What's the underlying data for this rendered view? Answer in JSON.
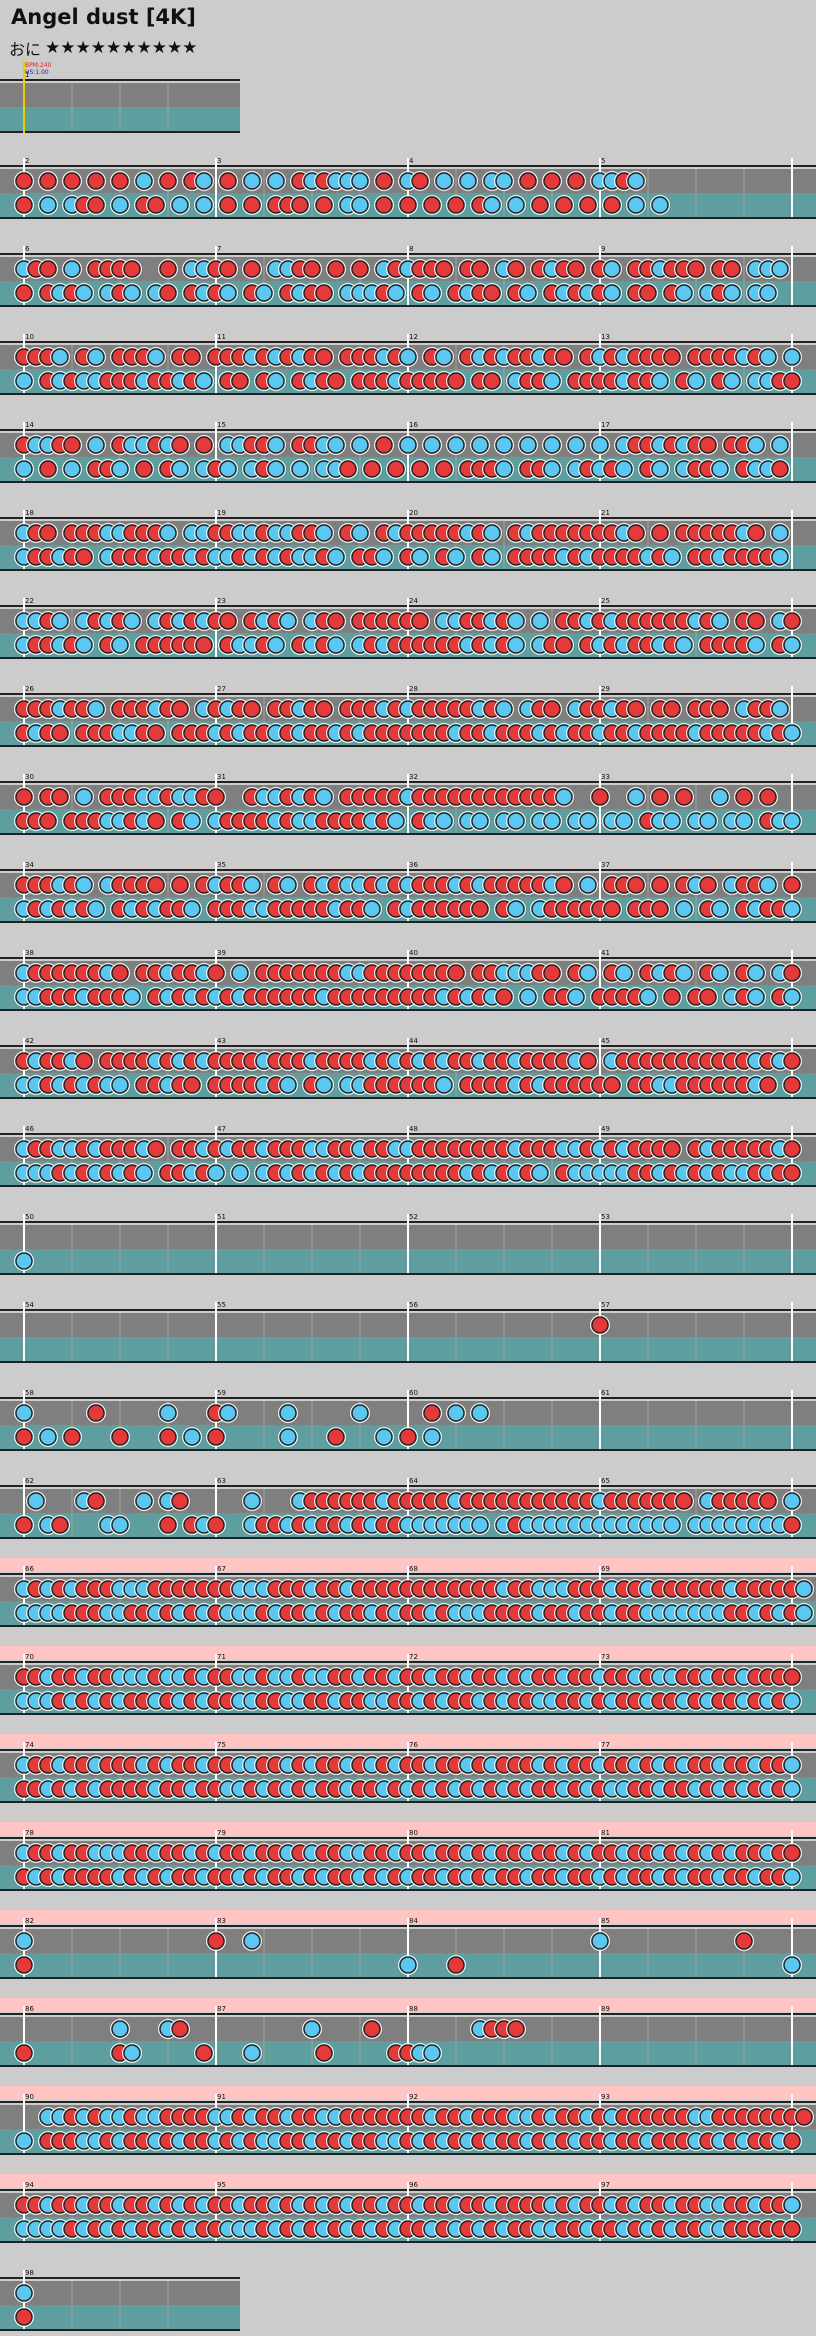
{
  "song": {
    "title": "Angel dust [4K]",
    "difficulty_label": "おに",
    "stars": "★★★★★★★★★★"
  },
  "header_marks": {
    "bpm": "BPM:240",
    "hs": "HS:1.00"
  },
  "colors": {
    "background": "#cccccc",
    "lane_top": "#7f7f7f",
    "lane_bottom": "#5f9e9e",
    "gogo_band": "#ffc4c4",
    "don": "#e63a3a",
    "ka": "#5ac8f0",
    "barline": "#ffffff",
    "beatline": "#a0a0a0",
    "start_line": "#e8d000",
    "measure_number": "#111111"
  },
  "chart": {
    "measures_per_row": 4,
    "divisions": 16,
    "rows": [
      {
        "first": 1,
        "count": 1,
        "gogo": false,
        "lanes": [
          "................",
          "................"
        ]
      },
      {
        "first": 2,
        "count": 4,
        "gogo": false,
        "lanes": [
          "o.o.o.o.o.k.o.ok.o.k.k.okokkk.o.ko.k.k.kk.o.o.o.kkok",
          "o.k.koo.k.oo.k.k.o.o.ooo.o.kk.o.o.o.o.ok.k.o.o.o.o.k.k"
        ]
      },
      {
        "first": 6,
        "count": 4,
        "gogo": false,
        "lanes": [
          "koo.k.oooo..o.kkoo.o.kkoo.o.o.kokooo.oo.ko.okoo.ok.ookooo.oo.kkk",
          "o.okok.kok.ko.okok.ok.okoo.kkkok.ok.okoo.ok.okokok.oo.ok.kok.kk"
        ]
      },
      {
        "first": 10,
        "count": 4,
        "gogo": false,
        "lanes": [
          "oook.ok.oook.oo.oookokokoo.oookok.ok.okokookoo.okokoooo.ooookok.k",
          "k.okokkoookookok.oo.ok.okoo.oookooooo.oo.kook.ooookook.ok.ok.kkoo"
        ]
      },
      {
        "first": 14,
        "count": 4,
        "gogo": false,
        "lanes": [
          "okkoo.k.okkoko.o.kkook.ookk.k.o.k.k.k.k.k.k.k.k.k.kookokoo.ook.k",
          "k.o.k.ook.o.ok.kok.kok.k.kko.o.o.o.o.oook.ook.kokok.ok.kook.okko"
        ]
      },
      {
        "first": 18,
        "count": 4,
        "gogo": false,
        "lanes": [
          "koo.oookkoook.kkookkokkook.ok.okoooookok.okoooooooko.o.oooooko.k",
          "kookoo.koookookokkokokokkok.ook.ok.ok.ok.ooookokooookok.ookooook"
        ]
      },
      {
        "first": 22,
        "count": 4,
        "gogo": false,
        "lanes": [
          "kkok.kokok.kokokoo.okok.koo.oooooo.kkookok.k.ookokooooookok.oo.ko",
          "kookok.ok.oooooo.okkok.okok.kokooooookokok.koo.okokookok.ooook.ok"
        ]
      },
      {
        "first": 26,
        "count": 4,
        "gogo": false,
        "lanes": [
          "oookook.oookoo.kokoo.ookoo.oookokoooookok.koo.kookoo.oo.ooo.kook",
          "okoo.oookkoo.oookokookokookokoooooookookoookokookookooookoooookok"
        ]
      },
      {
        "first": 30,
        "count": 4,
        "gogo": false,
        "lanes": [
          "o.oo.k.oookkokkoo..okkokok.oooookooooooooooook..o..k.o.o..k.o.o..",
          "ooo.oookkoko.ok.kooookokkooookok.okk.kk.kk.kk.kk.kk.okk.kk.kk.okk"
        ]
      },
      {
        "first": 34,
        "count": 4,
        "gogo": false,
        "lanes": [
          "oookok.koooo.o.okook.ok.okokkokokoookokoooooko.k.ooo.o.oko.kook.o",
          "kokokok.okokook.oookkoooookook.okoooooo.ok.koooooo.ooo.k.ok.okook"
        ]
      },
      {
        "first": 38,
        "count": 4,
        "gogo": false,
        "lanes": [
          "kooooooko.ookooko.k.oooooookkoooooooo.ookkkoo.ok.ok.okok.ok.ok.ko",
          "kkoookoook.okokokokooooookoooooooookokoko.k.ook.ooook.o.oo.kok.ok"
        ]
      },
      {
        "first": 42,
        "count": 4,
        "gogo": false,
        "lanes": [
          "okooko.ooookokokooookoookooookokokokookookooooko.koooooooooookoko",
          "kkokokokk.ookoo.ooookok.ok.kkooooook.ooookokoooooo.ookkooooooko.o"
        ]
      },
      {
        "first": 46,
        "count": 4,
        "gogo": false,
        "lanes": [
          "kookkokoooko.ookokookoookkookookkooooooookoookkokokoooo.okoooooko",
          "kkkokokokok.ookok.k.kokokokokooooooookokokok.okkkkkookokokokkokoo"
        ]
      },
      {
        "first": 50,
        "count": 4,
        "gogo": false,
        "lanes": [
          "................................................................",
          "k..............................................................."
        ]
      },
      {
        "first": 54,
        "count": 4,
        "gogo": false,
        "lanes": [
          "................................................o...............",
          "................................................................"
        ]
      },
      {
        "first": 58,
        "count": 4,
        "gogo": false,
        "lanes": [
          "k.....o.....k...ok....k.....k.....o.k.k.......",
          "o.k.o...o...o.k.o.....k...o...k.o.k"
        ]
      },
      {
        "first": 62,
        "count": 4,
        "gogo": false,
        "lanes": [
          ".k...ko...k.ko.....k...kooooookoooookoooooooooookooooooo.kooooo.k",
          "o.ko...kk...o.oko..kookokookokookkkkkkk.kokkkkkkkkkkkkk.kkkkkkkko"
        ]
      },
      {
        "first": 66,
        "count": 4,
        "gogo": true,
        "lanes": [
          "kokokoookkkoooooookkkoookookooooooooooookookkkoookookooooookoooook",
          "kkkkoookkookokokokkkokookokookokookokkkooookookookookkkkkkkookokok"
        ]
      },
      {
        "first": 70,
        "count": 4,
        "gogo": true,
        "lanes": [
          "ookookookkkokkokookkokkokkookookookookookokookookookokkookookoooo",
          "kkkokokokookokokookkookkookookkookokookokookkookokookookokookokok"
        ]
      },
      {
        "first": 74,
        "count": 4,
        "gogo": true,
        "lanes": [
          "kookookoookokookookkookokookokokookookokoookokookookokokookookook",
          "ookokokooookookookkokokokookookokokokokokokookokokkookookokokokok"
        ]
      },
      {
        "first": 78,
        "count": 4,
        "gogo": true,
        "lanes": [
          "kookookkkookookokookookokookkookookookokookookokookookokokokookoo",
          "okokooookokokookookokookokookokokookokokookookookokookokookookook"
        ]
      },
      {
        "first": 82,
        "count": 4,
        "gogo": true,
        "lanes": [
          "k...............o..k............................k...........o...",
          "o...............................k...o...........................k"
        ]
      },
      {
        "first": 86,
        "count": 4,
        "gogo": true,
        "lanes": [
          "........k...ko..........k....o........kooo......................",
          "o.......ok.....o...k.....o.....ookk.........................."
        ]
      },
      {
        "first": 90,
        "count": 4,
        "gogo": true,
        "lanes": [
          "..kkokokkokkooookkokookookkoooooookookoookkokookokooooookkoooooooo",
          "k.oookkokookokookokokkookookookkokokokokookokokookookoookokokooko"
        ]
      },
      {
        "first": 94,
        "count": 4,
        "gogo": true,
        "lanes": [
          "ookookookookokokookookokokokookookookookooookokookokookookkookook",
          "kkkkokokokookokookkkokokokokokokookokokokookkookookokokookkoooooo"
        ]
      },
      {
        "first": 98,
        "count": 1,
        "gogo": false,
        "lanes": [
          "k...............",
          "o..............."
        ]
      }
    ]
  }
}
